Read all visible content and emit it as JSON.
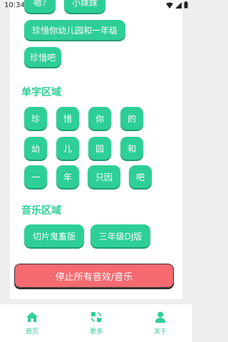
{
  "status": {
    "time": "10:34"
  },
  "top_row": [
    "嗯?",
    "小妹妹"
  ],
  "phrases": [
    "珍惜你幼儿园和一年级",
    "珍惜吧"
  ],
  "single_section": {
    "title": "单字区域",
    "words": [
      "珍",
      "惜",
      "你",
      "的",
      "幼",
      "儿",
      "园",
      "和",
      "一",
      "年",
      "只因",
      "吧"
    ]
  },
  "music_section": {
    "title": "音乐区域",
    "items": [
      "切片鬼畜版",
      "三年级DJ版"
    ]
  },
  "stop_label": "停止所有音效/音乐",
  "nav": [
    "首页",
    "更多",
    "关于"
  ],
  "colors": {
    "accent": "#2ecf96",
    "stop": "#f56b6f"
  }
}
